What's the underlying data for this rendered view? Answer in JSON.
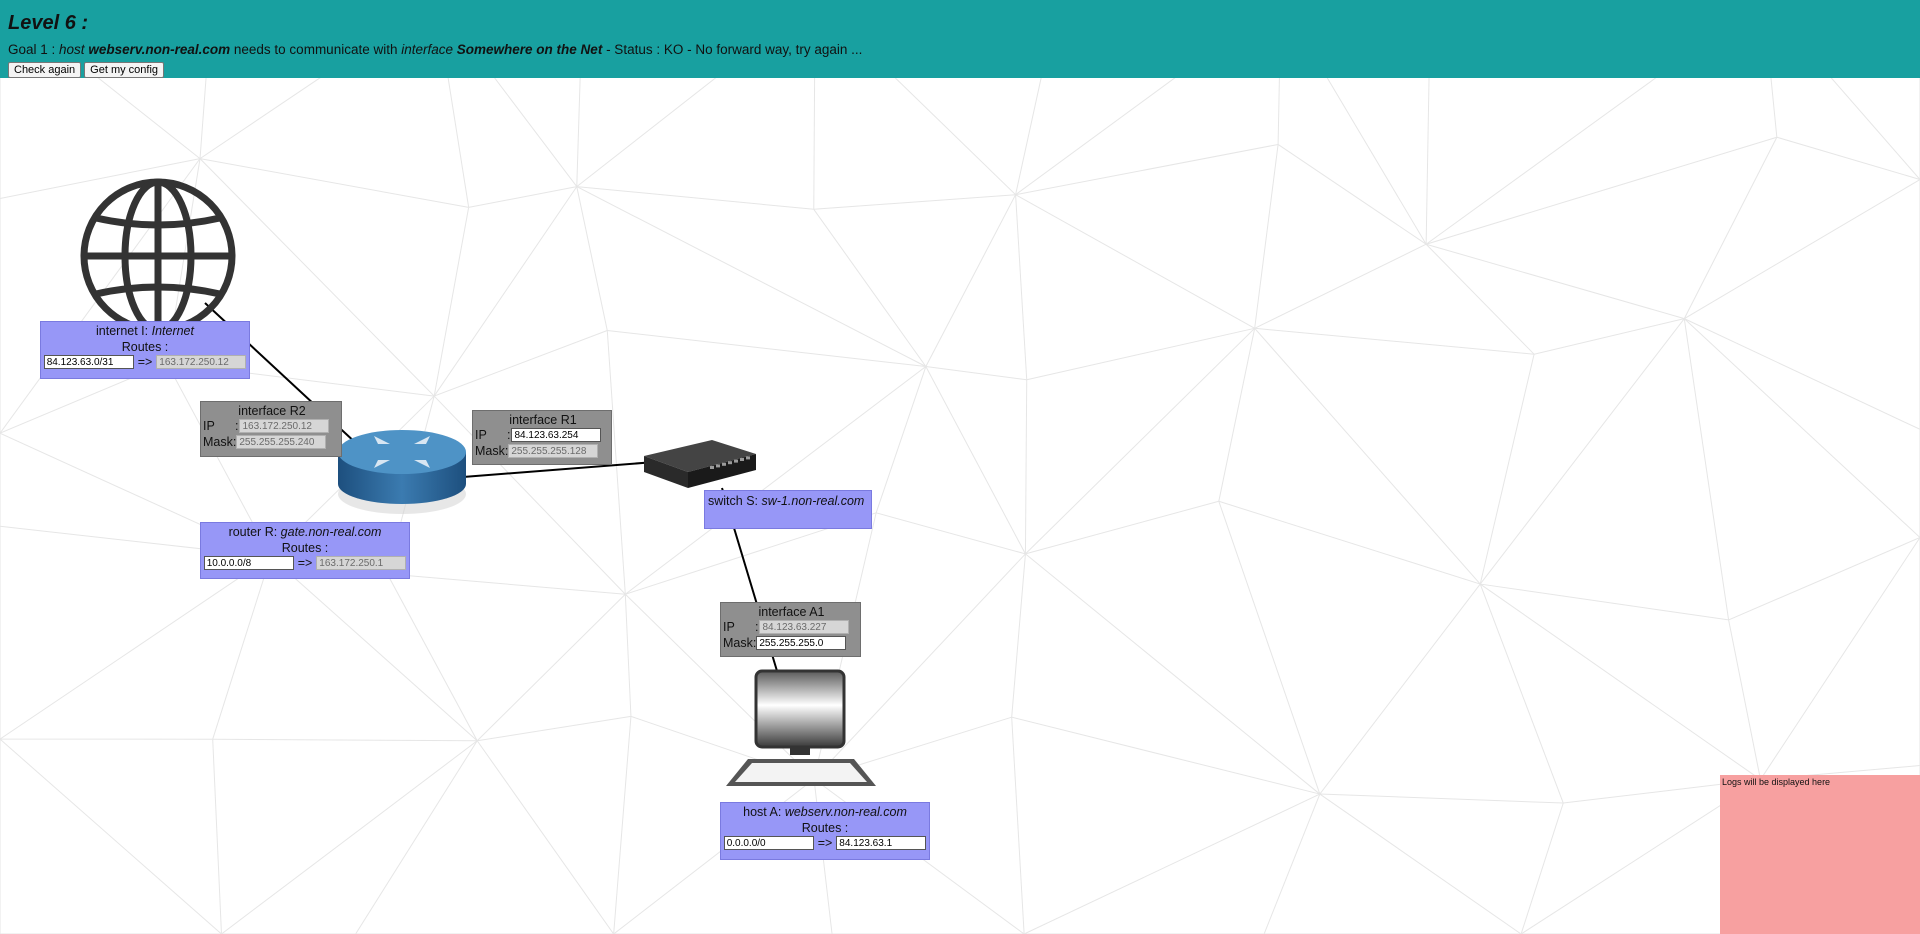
{
  "header": {
    "title": "Level 6 :",
    "goal": {
      "prefix": "Goal 1 : ",
      "host_word": "host",
      "host_name": "webserv.non-real.com",
      "middle": " needs to communicate with ",
      "interface_word": "interface",
      "interface_name": "Somewhere on the Net",
      "status": " - Status : KO - No forward way, try again ..."
    },
    "buttons": {
      "check": "Check again",
      "config": "Get my config"
    }
  },
  "internet": {
    "title_prefix": "internet I: ",
    "title_name": "Internet",
    "routes_label": "Routes :",
    "route_dest": "84.123.63.0/31",
    "arrow": "=>",
    "route_gw": "163.172.250.12"
  },
  "interface_r2": {
    "title": "interface R2",
    "ip_label": "IP",
    "ip_colon": ":",
    "ip": "163.172.250.12",
    "mask_label": "Mask",
    "mask_colon": ":",
    "mask": "255.255.255.240"
  },
  "interface_r1": {
    "title": "interface R1",
    "ip_label": "IP",
    "ip_colon": ":",
    "ip": "84.123.63.254",
    "mask_label": "Mask",
    "mask_colon": ":",
    "mask": "255.255.255.128"
  },
  "router": {
    "title_prefix": "router R: ",
    "title_name": "gate.non-real.com",
    "routes_label": "Routes :",
    "route_dest": "10.0.0.0/8",
    "arrow": "=>",
    "route_gw": "163.172.250.1"
  },
  "switch": {
    "title_prefix": "switch S: ",
    "title_name": "sw-1.non-real.com"
  },
  "interface_a1": {
    "title": "interface A1",
    "ip_label": "IP",
    "ip_colon": ":",
    "ip": "84.123.63.227",
    "mask_label": "Mask",
    "mask_colon": ":",
    "mask": "255.255.255.0"
  },
  "host": {
    "title_prefix": "host A: ",
    "title_name": "webserv.non-real.com",
    "routes_label": "Routes :",
    "route_dest": "0.0.0.0/0",
    "arrow": "=>",
    "route_gw": "84.123.63.1"
  },
  "logs": {
    "text": "Logs will be displayed here"
  },
  "colors": {
    "header": "#18a0a0",
    "device_box": "#9797f7",
    "interface_box": "#8f8f8f",
    "logs": "#f7a0a0"
  },
  "icons": [
    "globe-icon",
    "router-icon",
    "switch-icon",
    "computer-icon"
  ]
}
